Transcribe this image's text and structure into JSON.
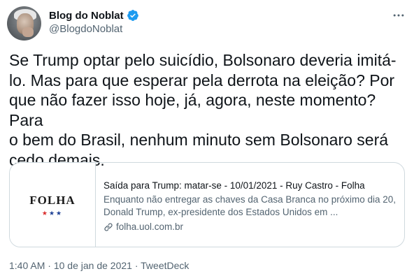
{
  "author": {
    "display_name": "Blog do Noblat",
    "handle": "@BlogdoNoblat",
    "verified": true
  },
  "tweet": {
    "text": "Se Trump optar pelo suicídio, Bolsonaro deveria imitá-\nlo. Mas para que esperar pela derrota na eleição? Por\nque não fazer isso hoje, já, agora, neste momento? Para\no bem do Brasil, nenhum minuto sem Bolsonaro será\ncedo demais."
  },
  "card": {
    "logo_text": "FOLHA",
    "title": "Saída para Trump: matar-se - 10/01/2021 - Ruy Castro - Folha",
    "description": "Enquanto não entregar as chaves da Casa Branca no próximo dia 20, Donald Trump, ex-presidente dos Estados Unidos em ...",
    "domain": "folha.uol.com.br"
  },
  "meta": {
    "time": "1:40 AM",
    "separator": " · ",
    "date": "10 de jan de 2021",
    "source": "TweetDeck"
  },
  "colors": {
    "verified_badge": "#1d9bf0",
    "secondary_text": "#536471",
    "border": "#cfd9de"
  },
  "icons": {
    "more": "more-options-icon",
    "verified": "verified-badge-icon",
    "link": "link-icon"
  }
}
